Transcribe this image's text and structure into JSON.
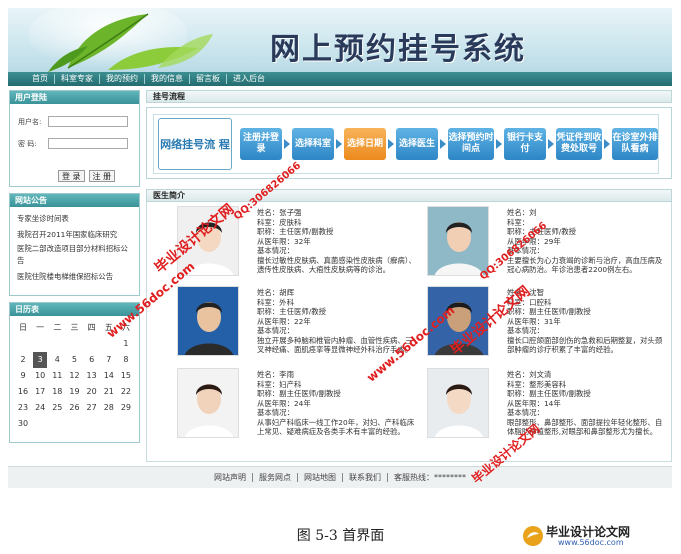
{
  "banner": {
    "title": "网上预约挂号系统"
  },
  "nav": {
    "items": [
      "首页",
      "科室专家",
      "我的预约",
      "我的信息",
      "留言板",
      "进入后台"
    ]
  },
  "login": {
    "title": "用户登陆",
    "username_label": "用户名:",
    "password_label": "密 码:",
    "login_button": "登 录",
    "register_button": "注 册"
  },
  "notice": {
    "title": "网站公告",
    "items": [
      "专家坐诊时间表",
      "我院召开2011年国家临床研究",
      "医院二部改造项目部分材料招标公告",
      "医院住院楼电梯维保招标公告"
    ]
  },
  "calendar": {
    "title": "日历表",
    "weekdays": [
      "日",
      "一",
      "二",
      "三",
      "四",
      "五",
      "六"
    ],
    "rows": [
      [
        "",
        "",
        "",
        "",
        "",
        "",
        "1"
      ],
      [
        "2",
        "3",
        "4",
        "5",
        "6",
        "7",
        "8"
      ],
      [
        "9",
        "10",
        "11",
        "12",
        "13",
        "14",
        "15"
      ],
      [
        "16",
        "17",
        "18",
        "19",
        "20",
        "21",
        "22"
      ],
      [
        "23",
        "24",
        "25",
        "26",
        "27",
        "28",
        "29"
      ],
      [
        "30",
        "",
        "",
        "",
        "",
        "",
        ""
      ]
    ],
    "today": "3"
  },
  "flow": {
    "section_title": "挂号流程",
    "head": "网络挂号流 程",
    "steps": [
      "注册并登 录",
      "选择科室",
      "选择日期",
      "选择医生",
      "选择预约时间点",
      "银行卡支付",
      "凭证件到收费处取号",
      "在诊室外排队看病"
    ],
    "active_step": 2
  },
  "doctors": {
    "section_title": "医生简介",
    "list": [
      {
        "name": "姓名：张子强",
        "dept": "科室：皮肤科",
        "title": "职称：主任医师/副教授",
        "years": "从医年限：32年",
        "info_label": "基本情况：",
        "desc": "擅长过敏性皮肤病、真菌感染性皮肤病（癣病）、遗传性皮肤病、大疱性皮肤病等的诊治。"
      },
      {
        "name": "姓名：刘",
        "dept": "科室：",
        "title": "职称：主任医师/教授",
        "years": "从医年限：29年",
        "info_label": "基本情况：",
        "desc": "主要擅长为心力衰竭的诊断与治疗，高血压病及冠心病防治。年诊治患者2200例左右。"
      },
      {
        "name": "姓名：胡辉",
        "dept": "科室：外科",
        "title": "职称：主任医师/教授",
        "years": "从医年限：22年",
        "info_label": "基本情况：",
        "desc": "独立开展多种脑和椎管内肿瘤、血管性疾病、三叉神经痛、面肌痉挛等显微神经外科治疗手术。"
      },
      {
        "name": "姓名：沈智",
        "dept": "科室：口腔科",
        "title": "职称：副主任医师/副教授",
        "years": "从医年限：31年",
        "info_label": "基本情况：",
        "desc": "擅长口腔颌面部创伤的急救和后期整复，对头颈部肿瘤的诊疗积累了丰富的经验。"
      },
      {
        "name": "姓名：李雨",
        "dept": "科室：妇产科",
        "title": "职称：副主任医师/副教授",
        "years": "从医年限：24年",
        "info_label": "基本情况：",
        "desc": "从事妇产科临床一线工作20年，对妇、产科临床上常见、疑难病症及各类手术有丰富的经验。"
      },
      {
        "name": "姓名：刘文清",
        "dept": "科室：整形美容科",
        "title": "职称：副主任医师/副教授",
        "years": "从医年限：14年",
        "info_label": "基本情况：",
        "desc": "眼部整形、鼻部整形、面部提拉年轻化整形、自体脂肪移植整形,对眼部和鼻部整形尤为擅长。"
      }
    ]
  },
  "footer": {
    "links": [
      "网站声明",
      "服务网点",
      "网站地图",
      "联系我们",
      "客服热线：********"
    ]
  },
  "caption": "图 5-3 首界面",
  "watermarks": {
    "site_name": "毕业设计论文网",
    "url": "www.56doc.com",
    "qq": "QQ:306826066"
  },
  "colors": {
    "nav": "#2f7d81",
    "step": "#3a8dc9",
    "step_active": "#ef8f24",
    "watermark": "#e02020"
  }
}
